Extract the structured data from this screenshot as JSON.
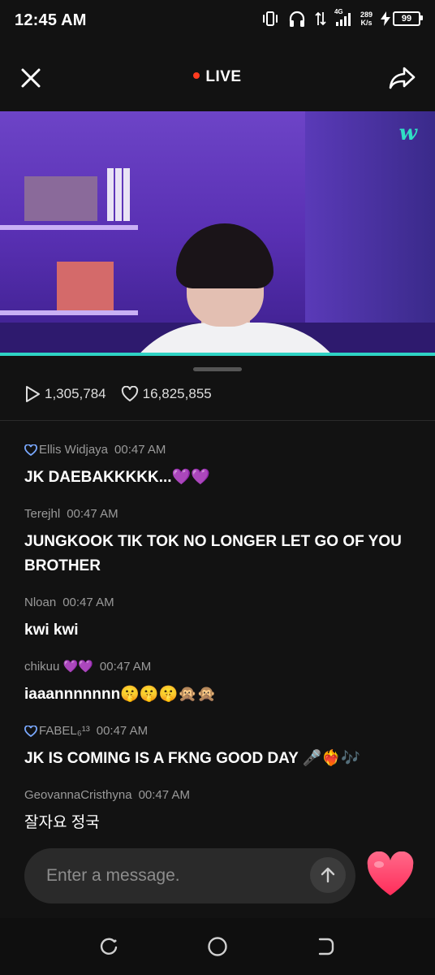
{
  "status_bar": {
    "time": "12:45 AM",
    "network_type": "4G",
    "net_speed_value": "289",
    "net_speed_unit": "K/s",
    "battery": "99"
  },
  "header": {
    "live_label": "LIVE"
  },
  "stats": {
    "plays": "1,305,784",
    "likes": "16,825,855"
  },
  "chat": {
    "messages": [
      {
        "user": "Ellis Widjaya",
        "time": "00:47 AM",
        "text": "JK DAEBAKKKKK...💜💜"
      },
      {
        "user": "Terejhl",
        "time": "00:47 AM",
        "text": "JUNGKOOK TIK TOK NO LONGER LET GO OF YOU BROTHER"
      },
      {
        "user": "Nloan",
        "time": "00:47 AM",
        "text": "kwi kwi"
      },
      {
        "user": "chikuu 💜💜",
        "time": "00:47 AM",
        "text": "iaaannnnnnn🤫🤫🤫🙊🙊"
      },
      {
        "user": "FABEL₆¹³",
        "time": "00:47 AM",
        "text": "JK IS COMING IS A FKNG GOOD DAY 🎤❤️‍🔥🎶"
      },
      {
        "user": "GeovannaCristhyna",
        "time": "00:47 AM",
        "text": "잘자요 정국"
      }
    ]
  },
  "composer": {
    "placeholder": "Enter a message."
  },
  "colors": {
    "live_dot": "#ff3b1f",
    "accent": "#2fd3c4",
    "heart": "#ff3b6b",
    "background": "#121212"
  }
}
